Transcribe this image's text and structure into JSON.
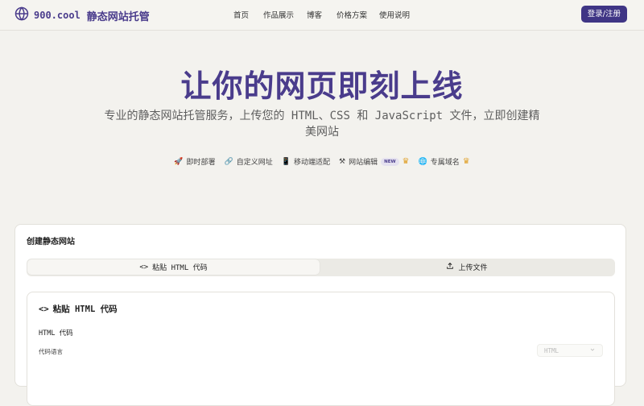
{
  "header": {
    "logo_icon": "globe-icon",
    "domain": "900.cool",
    "name": "静态网站托管",
    "nav": [
      "首页",
      "作品展示",
      "博客",
      "价格方案",
      "使用说明"
    ],
    "login_label": "登录/注册"
  },
  "hero": {
    "title": "让你的网页即刻上线",
    "subtitle": "专业的静态网站托管服务，上传您的 HTML、CSS 和 JavaScript 文件，立即创建精美网站"
  },
  "features": [
    {
      "icon": "🚀",
      "label": "即时部署"
    },
    {
      "icon": "🔗",
      "label": "自定义网址"
    },
    {
      "icon": "📱",
      "label": "移动端适配"
    },
    {
      "icon": "⚒",
      "label": "网站编辑",
      "badge": "NEW"
    },
    {
      "icon": "🌐",
      "label": "专属域名"
    }
  ],
  "card": {
    "title": "创建静态网站",
    "tabs": [
      {
        "icon": "<>",
        "label": "粘贴 HTML 代码"
      },
      {
        "icon": "upload-icon",
        "label": "上传文件"
      }
    ],
    "inner": {
      "icon": "<>",
      "title": "粘贴 HTML 代码",
      "field_label": "HTML 代码",
      "lang_label": "代码语言",
      "lang_value": "HTML"
    }
  },
  "colors": {
    "brand": "#4a3c8c",
    "button": "#3f3585",
    "background": "#f3f2ee",
    "crown": "#e0a12a"
  }
}
